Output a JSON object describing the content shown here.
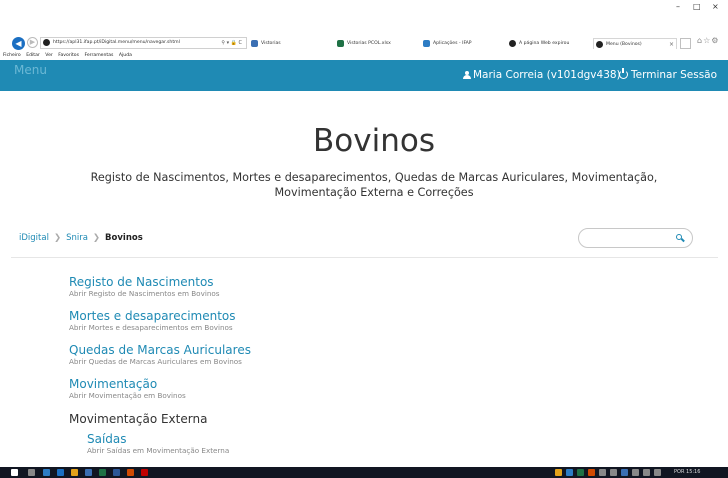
{
  "browser": {
    "address_url": "https://apl31.ifap.pt/iDigital.menu/menu/navegar.shtml",
    "tabs": [
      {
        "label": "Vistorias",
        "color": "#3b6fb3"
      },
      {
        "label": "Vistorias PCOL.xlsx",
        "color": "#1e7145"
      },
      {
        "label": "Aplicações - IFAP",
        "color": "#2d7cc4"
      },
      {
        "label": "A página Web expirou",
        "color": "#222222"
      },
      {
        "label": "Menu (Bovinos)",
        "color": "#222222"
      }
    ],
    "menubar": [
      "Ficheiro",
      "Editar",
      "Ver",
      "Favoritos",
      "Ferramentas",
      "Ajuda"
    ],
    "window_controls": [
      "–",
      "□",
      "×"
    ]
  },
  "header": {
    "brand": "Menu",
    "user_name": "Maria Correia (v101dgv438)",
    "logout_label": "Terminar Sessão",
    "accent_color": "#1f8ab4"
  },
  "page": {
    "title": "Bovinos",
    "subtitle": "Registo de Nascimentos, Mortes e desaparecimentos, Quedas de Marcas Auriculares, Movimentação, Movimentação Externa e Correções"
  },
  "breadcrumb": {
    "items": [
      "iDigital",
      "Snira",
      "Bovinos"
    ]
  },
  "search": {
    "value": "",
    "placeholder": ""
  },
  "menu": {
    "items": [
      {
        "title": "Registo de Nascimentos",
        "desc": "Abrir Registo de Nascimentos em Bovinos"
      },
      {
        "title": "Mortes e desaparecimentos",
        "desc": "Abrir Mortes e desaparecimentos em Bovinos"
      },
      {
        "title": "Quedas de Marcas Auriculares",
        "desc": "Abrir Quedas de Marcas Auriculares em Bovinos"
      },
      {
        "title": "Movimentação",
        "desc": "Abrir Movimentação em Bovinos"
      }
    ],
    "section": "Movimentação Externa",
    "sub_items": [
      {
        "title": "Saídas",
        "desc": "Abrir Saídas em Movimentação Externa"
      }
    ]
  },
  "taskbar": {
    "clock": "POR 15:16"
  }
}
